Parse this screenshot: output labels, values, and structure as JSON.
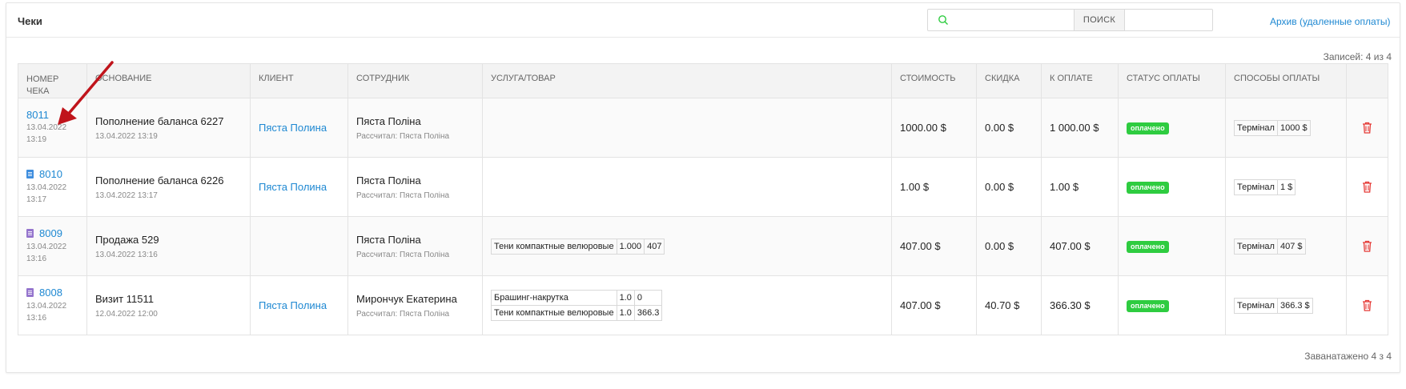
{
  "header": {
    "title": "Чеки",
    "search_placeholder": "",
    "search_button": "ПОИСК",
    "archive_link": "Архив (удаленные оплаты)"
  },
  "records_count": "Записей: 4 из 4",
  "records_footer": "Заванатажено 4 з 4",
  "columns": {
    "number": "НОМЕР ЧЕКА",
    "basis": "ОСНОВАНИЕ",
    "client": "КЛИЕНТ",
    "employee": "СОТРУДНИК",
    "service": "УСЛУГА/ТОВАР",
    "cost": "СТОИМОСТЬ",
    "discount": "СКИДКА",
    "to_pay": "К ОПЛАТЕ",
    "status": "СТАТУС ОПЛАТЫ",
    "methods": "СПОСОБЫ ОПЛАТЫ"
  },
  "rows": [
    {
      "number": "8011",
      "icon": "",
      "date": "13.04.2022",
      "time": "13:19",
      "basis": "Пополнение баланса 6227",
      "basis_date": "13.04.2022 13:19",
      "client": "Пяста Полина",
      "employee": "Пяста Поліна",
      "employee_sub": "Рассчитал: Пяста Поліна",
      "items": [],
      "cost": "1000.00 $",
      "discount": "0.00 $",
      "to_pay": "1 000.00 $",
      "status": "оплачено",
      "method": "Термінал",
      "method_amount": "1000 $"
    },
    {
      "number": "8010",
      "icon": "doc-icon-blue",
      "date": "13.04.2022",
      "time": "13:17",
      "basis": "Пополнение баланса 6226",
      "basis_date": "13.04.2022 13:17",
      "client": "Пяста Полина",
      "employee": "Пяста Поліна",
      "employee_sub": "Рассчитал: Пяста Поліна",
      "items": [],
      "cost": "1.00 $",
      "discount": "0.00 $",
      "to_pay": "1.00 $",
      "status": "оплачено",
      "method": "Термінал",
      "method_amount": "1 $"
    },
    {
      "number": "8009",
      "icon": "doc-icon-purple",
      "date": "13.04.2022",
      "time": "13:16",
      "basis": "Продажа 529",
      "basis_date": "13.04.2022 13:16",
      "client": "",
      "employee": "Пяста Поліна",
      "employee_sub": "Рассчитал: Пяста Поліна",
      "items": [
        {
          "name": "Тени компактные велюровые",
          "qty": "1.000",
          "price": "407"
        }
      ],
      "cost": "407.00 $",
      "discount": "0.00 $",
      "to_pay": "407.00 $",
      "status": "оплачено",
      "method": "Термінал",
      "method_amount": "407 $"
    },
    {
      "number": "8008",
      "icon": "doc-icon-purple",
      "date": "13.04.2022",
      "time": "13:16",
      "basis": "Визит 11511",
      "basis_date": "12.04.2022 12:00",
      "client": "Пяста Полина",
      "employee": "Мирончук Екатерина",
      "employee_sub": "Рассчитал: Пяста Поліна",
      "items": [
        {
          "name": "Брашинг-накрутка",
          "qty": "1.0",
          "price": "0"
        },
        {
          "name": "Тени компактные велюровые",
          "qty": "1.0",
          "price": "366.3"
        }
      ],
      "cost": "407.00 $",
      "discount": "40.70 $",
      "to_pay": "366.30 $",
      "status": "оплачено",
      "method": "Термінал",
      "method_amount": "366.3 $"
    }
  ],
  "colors": {
    "link": "#1e88d2",
    "badge": "#2ecc40",
    "delete": "#e53935",
    "annotation_arrow": "#c0141b",
    "doc_blue": "#3f8ede",
    "doc_purple": "#9575cd"
  }
}
